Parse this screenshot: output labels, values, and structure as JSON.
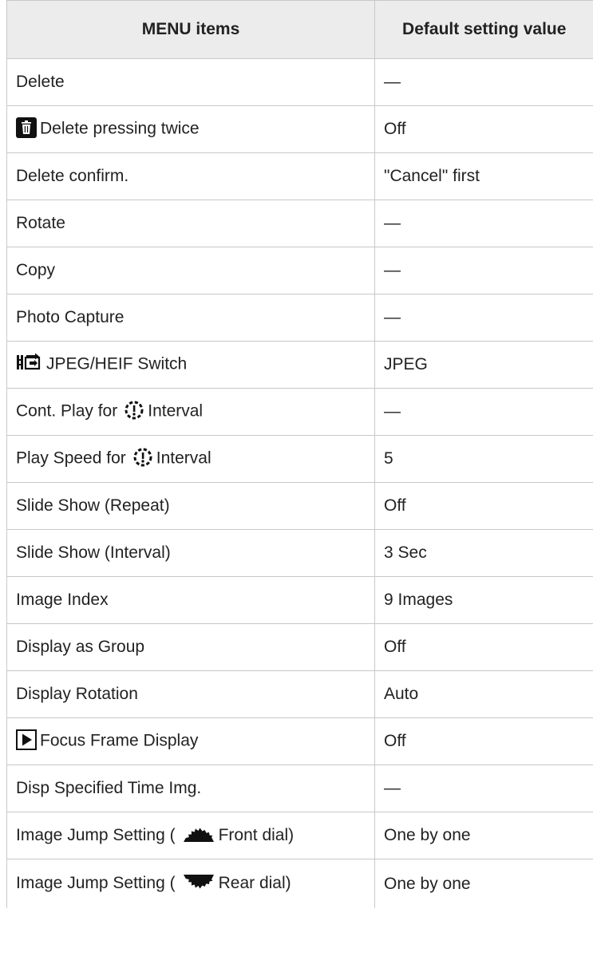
{
  "table": {
    "header": {
      "col1": "MENU items",
      "col2": "Default setting value"
    },
    "rows": [
      {
        "label": "Delete",
        "value": "—"
      },
      {
        "icon": "trash-icon",
        "label": "Delete pressing twice",
        "value": "Off"
      },
      {
        "label": "Delete confirm.",
        "value": "\"Cancel\" first"
      },
      {
        "label": "Rotate",
        "value": "—"
      },
      {
        "label": "Copy",
        "value": "—"
      },
      {
        "label": "Photo Capture",
        "value": "—"
      },
      {
        "icon": "format-switch-icon",
        "label": "JPEG/HEIF Switch",
        "value": "JPEG"
      },
      {
        "label_before": "Cont. Play for",
        "icon": "interval-icon",
        "label_after": "Interval",
        "value": "—"
      },
      {
        "label_before": "Play Speed for",
        "icon": "interval-icon",
        "label_after": "Interval",
        "value": "5"
      },
      {
        "label": "Slide Show (Repeat)",
        "value": "Off"
      },
      {
        "label": "Slide Show (Interval)",
        "value": "3 Sec"
      },
      {
        "label": "Image Index",
        "value": "9 Images"
      },
      {
        "label": "Display as Group",
        "value": "Off"
      },
      {
        "label": "Display Rotation",
        "value": "Auto"
      },
      {
        "icon": "playback-icon",
        "label": "Focus Frame Display",
        "value": "Off"
      },
      {
        "label": "Disp Specified Time Img.",
        "value": "—"
      },
      {
        "label_before": "Image Jump Setting (",
        "icon": "front-dial-icon",
        "label_after": "Front dial)",
        "value": "One by one"
      },
      {
        "label_before": "Image Jump Setting (",
        "icon": "rear-dial-icon",
        "label_after": "Rear dial)",
        "value": "One by one"
      }
    ]
  }
}
